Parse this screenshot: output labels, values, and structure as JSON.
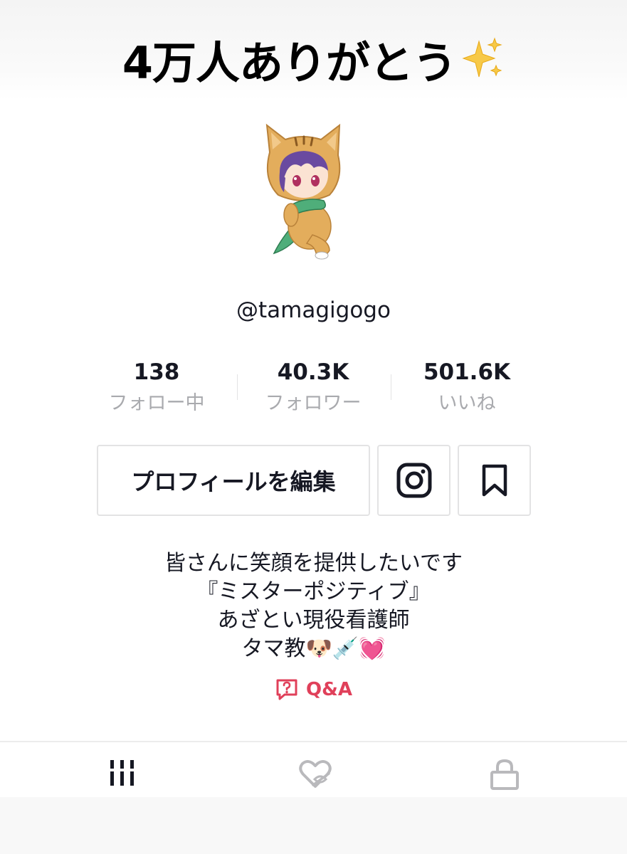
{
  "banner": {
    "text": "4万人ありがとう",
    "emoji_icon": "sparkles-icon"
  },
  "profile": {
    "username": "@tamagigogo",
    "avatar_icon": "tiger-hood-character-avatar"
  },
  "stats": [
    {
      "value": "138",
      "label": "フォロー中"
    },
    {
      "value": "40.3K",
      "label": "フォロワー"
    },
    {
      "value": "501.6K",
      "label": "いいね"
    }
  ],
  "actions": {
    "edit_profile": "プロフィールを編集",
    "instagram_icon": "instagram-icon",
    "bookmark_icon": "bookmark-icon"
  },
  "bio": {
    "lines": [
      "皆さんに笑顔を提供したいです",
      "『ミスターポジティブ』",
      "あざとい現役看護師",
      "タマ教🐶💉💓"
    ]
  },
  "qa": {
    "label": "Q&A",
    "icon": "question-bubble-icon"
  },
  "tabs": [
    {
      "name": "videos",
      "icon": "grid-lines-icon",
      "active": true
    },
    {
      "name": "liked",
      "icon": "heart-hidden-icon",
      "active": false
    },
    {
      "name": "private",
      "icon": "lock-icon",
      "active": false
    }
  ],
  "colors": {
    "accent": "#e0405a",
    "text": "#161823",
    "muted": "#a9aaae",
    "border": "#e3e3e4",
    "tab_inactive": "#b9b9bc"
  }
}
